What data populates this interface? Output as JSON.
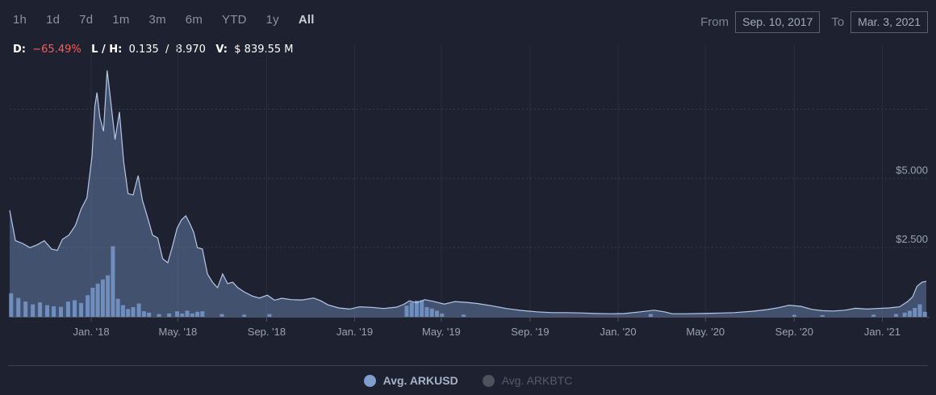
{
  "ranges": [
    {
      "label": "1h",
      "active": false
    },
    {
      "label": "1d",
      "active": false
    },
    {
      "label": "7d",
      "active": false
    },
    {
      "label": "1m",
      "active": false
    },
    {
      "label": "3m",
      "active": false
    },
    {
      "label": "6m",
      "active": false
    },
    {
      "label": "YTD",
      "active": false
    },
    {
      "label": "1y",
      "active": false
    },
    {
      "label": "All",
      "active": true
    }
  ],
  "date_range": {
    "from_label": "From",
    "from": "Sep. 10, 2017",
    "to_label": "To",
    "to": "Mar. 3, 2021"
  },
  "stats": {
    "d_label": "D:",
    "d_value": "−65.49%",
    "lh_label": "L / H:",
    "lh_value": "0.135  /  8.970",
    "v_label": "V:",
    "v_value": "$ 839.55 M"
  },
  "colors": {
    "background": "#1e2230",
    "area": "#6f8cba",
    "line": "#b7c8e6",
    "volume": "#7ea5dc",
    "negative": "#ff5b55"
  },
  "chart_data": {
    "type": "area",
    "title": "",
    "x_axis": {
      "type": "date",
      "range": [
        "2017-09-10",
        "2021-03-03"
      ],
      "tick_labels": [
        "Jan. '18",
        "May. '18",
        "Sep. '18",
        "Jan. '19",
        "May. '19",
        "Sep. '19",
        "Jan. '20",
        "May. '20",
        "Sep. '20",
        "Jan. '21"
      ],
      "tick_dates": [
        "2018-01-01",
        "2018-05-01",
        "2018-09-01",
        "2019-01-01",
        "2019-05-01",
        "2019-09-01",
        "2020-01-01",
        "2020-05-01",
        "2020-09-01",
        "2021-01-01"
      ]
    },
    "y_axis": {
      "tick_labels": [
        "$2.500",
        "$5.000"
      ],
      "tick_values": [
        2.5,
        5.0
      ],
      "range": [
        0,
        8.97
      ],
      "grid": true
    },
    "series": [
      {
        "name": "Avg. ARKUSD",
        "type": "area",
        "points": [
          [
            "2017-09-10",
            3.85
          ],
          [
            "2017-09-18",
            2.75
          ],
          [
            "2017-09-28",
            2.65
          ],
          [
            "2017-10-08",
            2.5
          ],
          [
            "2017-10-18",
            2.6
          ],
          [
            "2017-10-28",
            2.75
          ],
          [
            "2017-11-07",
            2.45
          ],
          [
            "2017-11-15",
            2.4
          ],
          [
            "2017-11-22",
            2.8
          ],
          [
            "2017-12-01",
            2.95
          ],
          [
            "2017-12-10",
            3.3
          ],
          [
            "2017-12-18",
            3.9
          ],
          [
            "2017-12-26",
            4.3
          ],
          [
            "2018-01-02",
            5.8
          ],
          [
            "2018-01-06",
            7.6
          ],
          [
            "2018-01-09",
            8.1
          ],
          [
            "2018-01-13",
            7.2
          ],
          [
            "2018-01-18",
            6.7
          ],
          [
            "2018-01-23",
            8.9
          ],
          [
            "2018-01-28",
            7.8
          ],
          [
            "2018-02-03",
            6.4
          ],
          [
            "2018-02-09",
            7.4
          ],
          [
            "2018-02-15",
            5.6
          ],
          [
            "2018-02-21",
            4.45
          ],
          [
            "2018-02-28",
            4.4
          ],
          [
            "2018-03-07",
            5.1
          ],
          [
            "2018-03-13",
            4.2
          ],
          [
            "2018-03-20",
            3.6
          ],
          [
            "2018-03-27",
            2.95
          ],
          [
            "2018-04-03",
            2.85
          ],
          [
            "2018-04-10",
            2.1
          ],
          [
            "2018-04-17",
            1.95
          ],
          [
            "2018-04-23",
            2.5
          ],
          [
            "2018-04-30",
            3.2
          ],
          [
            "2018-05-06",
            3.5
          ],
          [
            "2018-05-12",
            3.65
          ],
          [
            "2018-05-18",
            3.35
          ],
          [
            "2018-05-23",
            3.05
          ],
          [
            "2018-05-28",
            2.5
          ],
          [
            "2018-06-04",
            2.45
          ],
          [
            "2018-06-11",
            1.55
          ],
          [
            "2018-06-18",
            1.25
          ],
          [
            "2018-06-25",
            1.05
          ],
          [
            "2018-07-02",
            1.55
          ],
          [
            "2018-07-09",
            1.2
          ],
          [
            "2018-07-16",
            1.25
          ],
          [
            "2018-07-23",
            1.05
          ],
          [
            "2018-08-01",
            0.9
          ],
          [
            "2018-08-12",
            0.75
          ],
          [
            "2018-08-22",
            0.68
          ],
          [
            "2018-09-02",
            0.78
          ],
          [
            "2018-09-12",
            0.6
          ],
          [
            "2018-09-22",
            0.67
          ],
          [
            "2018-10-05",
            0.62
          ],
          [
            "2018-10-20",
            0.61
          ],
          [
            "2018-11-05",
            0.68
          ],
          [
            "2018-11-15",
            0.58
          ],
          [
            "2018-11-25",
            0.43
          ],
          [
            "2018-12-10",
            0.32
          ],
          [
            "2018-12-25",
            0.28
          ],
          [
            "2019-01-08",
            0.36
          ],
          [
            "2019-01-25",
            0.34
          ],
          [
            "2019-02-10",
            0.3
          ],
          [
            "2019-02-28",
            0.35
          ],
          [
            "2019-03-10",
            0.45
          ],
          [
            "2019-03-18",
            0.58
          ],
          [
            "2019-03-28",
            0.5
          ],
          [
            "2019-04-08",
            0.62
          ],
          [
            "2019-04-20",
            0.56
          ],
          [
            "2019-05-05",
            0.46
          ],
          [
            "2019-05-20",
            0.55
          ],
          [
            "2019-06-05",
            0.52
          ],
          [
            "2019-06-20",
            0.48
          ],
          [
            "2019-07-10",
            0.4
          ],
          [
            "2019-07-30",
            0.3
          ],
          [
            "2019-08-20",
            0.23
          ],
          [
            "2019-09-10",
            0.18
          ],
          [
            "2019-10-01",
            0.15
          ],
          [
            "2019-10-20",
            0.15
          ],
          [
            "2019-11-10",
            0.14
          ],
          [
            "2019-12-01",
            0.12
          ],
          [
            "2019-12-20",
            0.11
          ],
          [
            "2020-01-10",
            0.12
          ],
          [
            "2020-02-01",
            0.18
          ],
          [
            "2020-02-20",
            0.24
          ],
          [
            "2020-03-05",
            0.18
          ],
          [
            "2020-03-16",
            0.11
          ],
          [
            "2020-04-05",
            0.11
          ],
          [
            "2020-04-25",
            0.12
          ],
          [
            "2020-05-15",
            0.13
          ],
          [
            "2020-06-10",
            0.15
          ],
          [
            "2020-07-05",
            0.2
          ],
          [
            "2020-07-25",
            0.26
          ],
          [
            "2020-08-10",
            0.33
          ],
          [
            "2020-08-25",
            0.42
          ],
          [
            "2020-09-10",
            0.38
          ],
          [
            "2020-09-25",
            0.27
          ],
          [
            "2020-10-10",
            0.22
          ],
          [
            "2020-10-25",
            0.21
          ],
          [
            "2020-11-10",
            0.24
          ],
          [
            "2020-11-25",
            0.31
          ],
          [
            "2020-12-10",
            0.28
          ],
          [
            "2020-12-25",
            0.3
          ],
          [
            "2021-01-10",
            0.32
          ],
          [
            "2021-01-25",
            0.36
          ],
          [
            "2021-02-05",
            0.55
          ],
          [
            "2021-02-12",
            0.72
          ],
          [
            "2021-02-18",
            1.1
          ],
          [
            "2021-02-25",
            1.25
          ],
          [
            "2021-03-03",
            1.28
          ]
        ]
      },
      {
        "name": "Avg. ARKBTC",
        "visible": false
      }
    ],
    "volume": {
      "points": [
        [
          "2017-09-12",
          0.85
        ],
        [
          "2017-09-22",
          0.68
        ],
        [
          "2017-10-02",
          0.55
        ],
        [
          "2017-10-12",
          0.45
        ],
        [
          "2017-10-22",
          0.52
        ],
        [
          "2017-11-01",
          0.42
        ],
        [
          "2017-11-10",
          0.38
        ],
        [
          "2017-11-20",
          0.36
        ],
        [
          "2017-11-30",
          0.55
        ],
        [
          "2017-12-09",
          0.6
        ],
        [
          "2017-12-18",
          0.5
        ],
        [
          "2017-12-27",
          0.78
        ],
        [
          "2018-01-03",
          1.05
        ],
        [
          "2018-01-10",
          1.2
        ],
        [
          "2018-01-17",
          1.35
        ],
        [
          "2018-01-24",
          1.5
        ],
        [
          "2018-01-31",
          2.55
        ],
        [
          "2018-02-07",
          0.65
        ],
        [
          "2018-02-14",
          0.42
        ],
        [
          "2018-02-21",
          0.28
        ],
        [
          "2018-02-28",
          0.35
        ],
        [
          "2018-03-08",
          0.48
        ],
        [
          "2018-03-15",
          0.2
        ],
        [
          "2018-03-22",
          0.15
        ],
        [
          "2018-04-05",
          0.1
        ],
        [
          "2018-04-19",
          0.12
        ],
        [
          "2018-04-30",
          0.2
        ],
        [
          "2018-05-07",
          0.12
        ],
        [
          "2018-05-14",
          0.22
        ],
        [
          "2018-05-21",
          0.12
        ],
        [
          "2018-05-28",
          0.18
        ],
        [
          "2018-06-04",
          0.2
        ],
        [
          "2018-07-01",
          0.1
        ],
        [
          "2018-08-01",
          0.08
        ],
        [
          "2018-09-05",
          0.1
        ],
        [
          "2019-03-14",
          0.4
        ],
        [
          "2019-03-21",
          0.52
        ],
        [
          "2019-03-28",
          0.58
        ],
        [
          "2019-04-04",
          0.6
        ],
        [
          "2019-04-11",
          0.35
        ],
        [
          "2019-04-18",
          0.3
        ],
        [
          "2019-04-25",
          0.22
        ],
        [
          "2019-05-02",
          0.12
        ],
        [
          "2019-06-01",
          0.08
        ],
        [
          "2020-02-15",
          0.1
        ],
        [
          "2020-09-01",
          0.07
        ],
        [
          "2020-10-10",
          0.06
        ],
        [
          "2020-12-20",
          0.08
        ],
        [
          "2021-01-20",
          0.1
        ],
        [
          "2021-02-01",
          0.15
        ],
        [
          "2021-02-08",
          0.22
        ],
        [
          "2021-02-15",
          0.32
        ],
        [
          "2021-02-22",
          0.45
        ],
        [
          "2021-03-01",
          0.18
        ]
      ]
    },
    "legend": {
      "placement": "bottom-center",
      "items": [
        "Avg. ARKUSD",
        "Avg. ARKBTC"
      ]
    }
  },
  "legend": {
    "item1": "Avg. ARKUSD",
    "item2": "Avg. ARKBTC"
  }
}
